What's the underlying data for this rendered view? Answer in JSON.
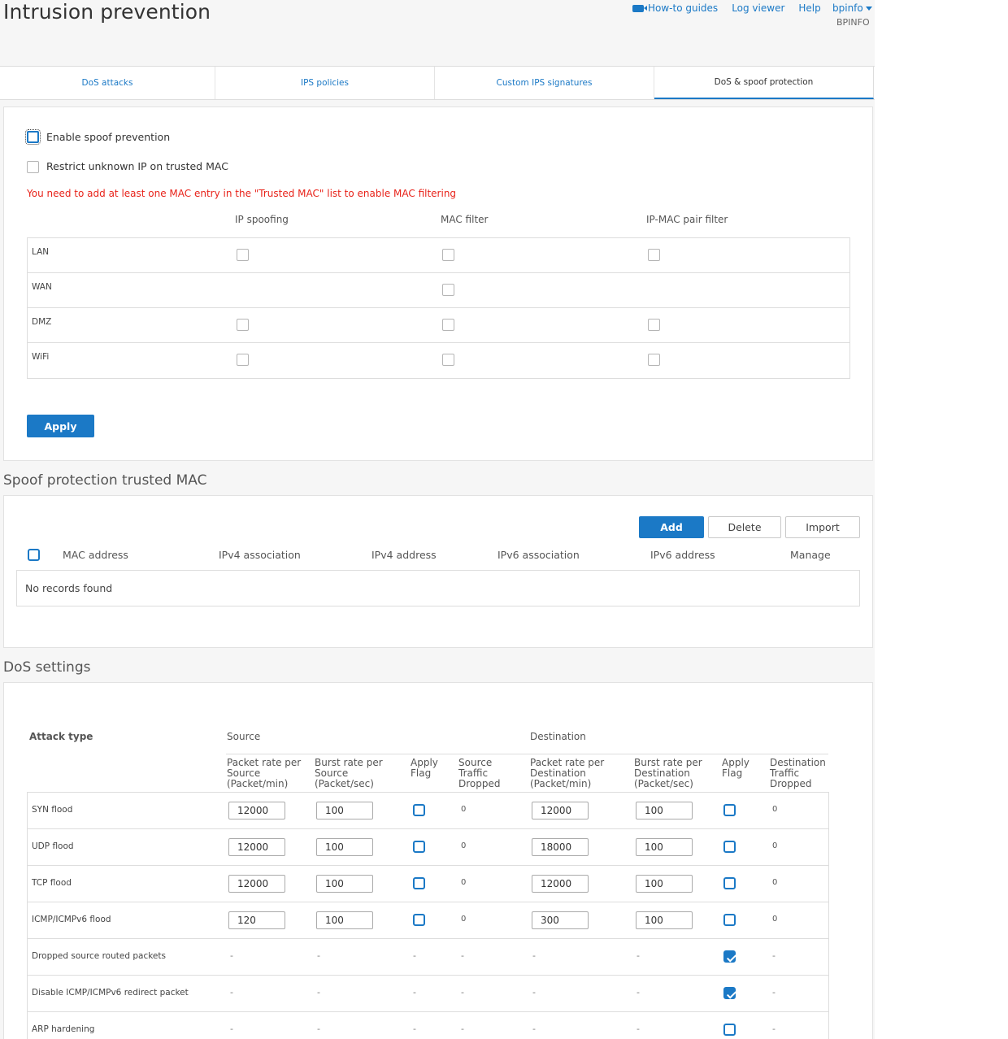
{
  "header": {
    "title": "Intrusion prevention",
    "how_to": "How-to guides",
    "log_viewer": "Log viewer",
    "help": "Help",
    "user": "bpinfo",
    "user_sub": "BPINFO"
  },
  "tabs": [
    "DoS attacks",
    "IPS policies",
    "Custom IPS signatures",
    "DoS & spoof protection"
  ],
  "spoof": {
    "enable_label": "Enable spoof prevention",
    "restrict_label": "Restrict unknown IP on trusted MAC",
    "error": "You need to add at least one MAC entry in the \"Trusted MAC\" list to enable MAC filtering",
    "columns": [
      "IP spoofing",
      "MAC filter",
      "IP-MAC pair filter"
    ],
    "zones": [
      "LAN",
      "WAN",
      "DMZ",
      "WiFi"
    ],
    "apply": "Apply"
  },
  "trusted_mac": {
    "title": "Spoof protection trusted MAC",
    "add": "Add",
    "delete": "Delete",
    "import": "Import",
    "columns": [
      "MAC address",
      "IPv4 association",
      "IPv4 address",
      "IPv6 association",
      "IPv6 address",
      "Manage"
    ],
    "empty": "No records found"
  },
  "dos": {
    "title": "DoS settings",
    "attack_type": "Attack type",
    "source": "Source",
    "destination": "Destination",
    "sub": {
      "src_packet": "Packet rate per Source (Packet/min)",
      "src_burst": "Burst rate per Source (Packet/sec)",
      "src_flag": "Apply Flag",
      "src_dropped": "Source Traffic Dropped",
      "dst_packet": "Packet rate per Destination (Packet/min)",
      "dst_burst": "Burst rate per Destination (Packet/sec)",
      "dst_flag": "Apply Flag",
      "dst_dropped": "Destination Traffic Dropped"
    },
    "rows": [
      {
        "name": "SYN flood",
        "src_packet": "12000",
        "src_burst": "100",
        "src_flag": false,
        "src_dropped": "0",
        "dst_packet": "12000",
        "dst_burst": "100",
        "dst_flag": false,
        "dst_dropped": "0"
      },
      {
        "name": "UDP flood",
        "src_packet": "12000",
        "src_burst": "100",
        "src_flag": false,
        "src_dropped": "0",
        "dst_packet": "18000",
        "dst_burst": "100",
        "dst_flag": false,
        "dst_dropped": "0"
      },
      {
        "name": "TCP flood",
        "src_packet": "12000",
        "src_burst": "100",
        "src_flag": false,
        "src_dropped": "0",
        "dst_packet": "12000",
        "dst_burst": "100",
        "dst_flag": false,
        "dst_dropped": "0"
      },
      {
        "name": "ICMP/ICMPv6 flood",
        "src_packet": "120",
        "src_burst": "100",
        "src_flag": false,
        "src_dropped": "0",
        "dst_packet": "300",
        "dst_burst": "100",
        "dst_flag": false,
        "dst_dropped": "0"
      },
      {
        "name": "Dropped source routed packets",
        "dash": "-",
        "dst_flag": true
      },
      {
        "name": "Disable ICMP/ICMPv6 redirect packet",
        "dash": "-",
        "dst_flag": true
      },
      {
        "name": "ARP hardening",
        "dash": "-",
        "dst_flag": false
      }
    ]
  }
}
